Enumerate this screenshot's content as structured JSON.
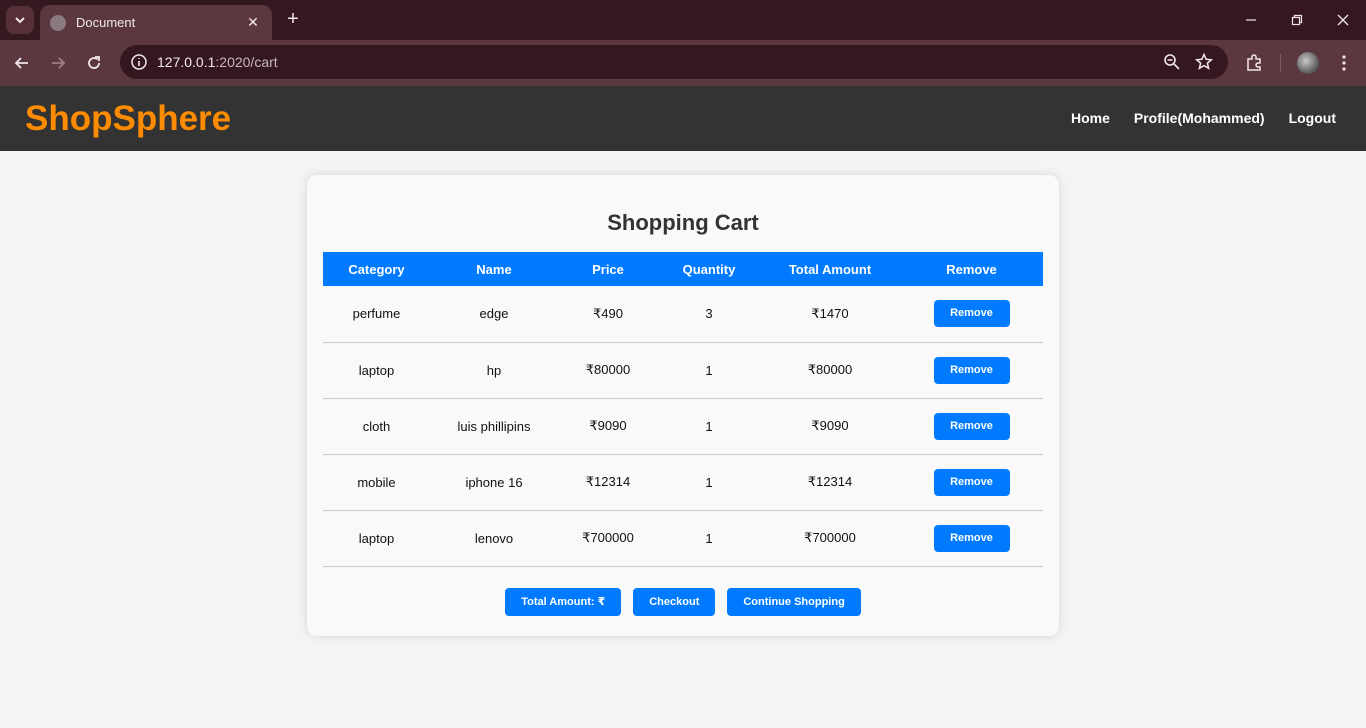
{
  "browser": {
    "tab_title": "Document",
    "url_host": "127.0.0.1",
    "url_path": ":2020/cart"
  },
  "site": {
    "brand": "ShopSphere",
    "nav": [
      "Home",
      "Profile(Mohammed)",
      "Logout"
    ]
  },
  "cart": {
    "title": "Shopping Cart",
    "headers": [
      "Category",
      "Name",
      "Price",
      "Quantity",
      "Total Amount",
      "Remove"
    ],
    "rows": [
      {
        "category": "perfume",
        "name": "edge",
        "price": "₹490",
        "quantity": "3",
        "total": "₹1470",
        "remove": "Remove"
      },
      {
        "category": "laptop",
        "name": "hp",
        "price": "₹80000",
        "quantity": "1",
        "total": "₹80000",
        "remove": "Remove"
      },
      {
        "category": "cloth",
        "name": "luis phillipins",
        "price": "₹9090",
        "quantity": "1",
        "total": "₹9090",
        "remove": "Remove"
      },
      {
        "category": "mobile",
        "name": "iphone 16",
        "price": "₹12314",
        "quantity": "1",
        "total": "₹12314",
        "remove": "Remove"
      },
      {
        "category": "laptop",
        "name": "lenovo",
        "price": "₹700000",
        "quantity": "1",
        "total": "₹700000",
        "remove": "Remove"
      }
    ],
    "total_button": "Total Amount: ₹",
    "checkout_button": "Checkout",
    "continue_button": "Continue Shopping"
  },
  "colors": {
    "accent": "#007bff",
    "brand": "#ff8c00",
    "header_bg": "#333333"
  }
}
